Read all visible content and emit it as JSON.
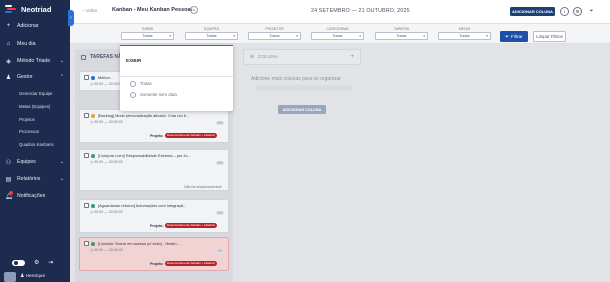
{
  "app": {
    "name": "Neotriad"
  },
  "sidebar": {
    "add_label": "Adicionar",
    "items": [
      {
        "label": "Meu dia",
        "icon": "home-icon"
      },
      {
        "label": "Método Triade",
        "icon": "triad-icon"
      },
      {
        "label": "Gestor",
        "icon": "person-icon"
      }
    ],
    "gestor_sub": [
      "Gerenciar Equipe",
      "Metas (Equipes)",
      "Projetos",
      "Processos",
      "Quadros Kanbans"
    ],
    "lower_items": [
      {
        "label": "Equipes",
        "icon": "people-icon"
      },
      {
        "label": "Relatórios",
        "icon": "report-icon"
      },
      {
        "label": "Notificações",
        "icon": "bell-icon"
      }
    ],
    "user_name": "Henrique"
  },
  "header": {
    "back_label": "‹ Voltar",
    "board_title": "Kanban - Meu Kanban Pessoal",
    "date_range": "24 SETEMBRO — 21 OUTUBRO, 2025",
    "add_column_label": "ADICIONAR COLUNA"
  },
  "filters": {
    "items": [
      {
        "label": "EXIBIR",
        "value": "Todas"
      },
      {
        "label": "EQUIPES",
        "value": "Todas"
      },
      {
        "label": "PROJETOS",
        "value": "Todos"
      },
      {
        "label": "CATEGORIAS",
        "value": "Todas"
      },
      {
        "label": "TAREFAS",
        "value": "Todas"
      },
      {
        "label": "METAS",
        "value": "Todas"
      }
    ],
    "filter_button": "Filtrar",
    "clear_button": "Limpar Filtros"
  },
  "dropdown": {
    "title": "EXIBIR",
    "options": [
      "Todas",
      "Somente sem data"
    ]
  },
  "column": {
    "title": "TAREFAS NÃO...",
    "cards": [
      {
        "title": "Melhor...",
        "time": "00:00 — 00:00:00",
        "dot": "#2f6fd6"
      },
      {
        "title": "[Backlog] Modo personalização ativado: Criar um b...",
        "time": "00:00 — 00:00:00",
        "badge": "0%",
        "project_label": "Projeto:",
        "project": "Desenvolvimento Afinado + Hitebrar",
        "dot": "#e8a23a"
      },
      {
        "title": "[Comprar Livro] Responsabilidade Extrema – por Jo...",
        "time": "00:30 — 00:00:00",
        "badge": "0%",
        "note": "Não há relacionamentos!",
        "dot": "#3aa06a"
      },
      {
        "title": "[Aguardando retorno] Automações com Integraçã...",
        "time": "00:00 — 00:00:00",
        "badge": "0%",
        "project_label": "Projeto:",
        "project": "Desenvolvimento Afinado + Hitebrar",
        "dot": "#3aa06a"
      },
      {
        "title": "[Concluir: Entrar em acesso (c/ exito) - Hestin...",
        "time": "00:00 — 00:00:00",
        "badge": "0%",
        "project_label": "Projeto:",
        "project": "Desenvolvimento Afinado + Hitebrar",
        "dot": "#3aa06a"
      }
    ]
  },
  "new_column": {
    "title": "COLUNA",
    "empty_message": "Adicione mais colunas para se organizar",
    "button": "ADICIONAR COLUNA"
  },
  "colors": {
    "sidebar": "#1d2b4f",
    "accent": "#2f6fd6",
    "danger": "#b4232a"
  }
}
